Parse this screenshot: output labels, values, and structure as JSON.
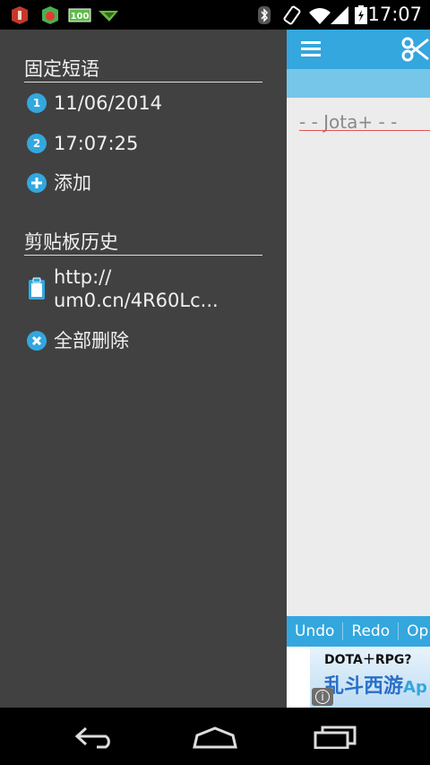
{
  "status_bar": {
    "time": "17:07",
    "notification_icons": [
      "fire-extinguisher-app-icon",
      "security-shield-app-icon",
      "battery-100-badge-icon",
      "paper-plane-app-icon"
    ],
    "system_icons": [
      "bluetooth-icon",
      "rotation-icon",
      "wifi-icon",
      "signal-icon",
      "battery-charging-icon"
    ]
  },
  "drawer": {
    "section_fixed": {
      "title": "固定短语",
      "items": [
        {
          "index": "1",
          "text": "11/06/2014"
        },
        {
          "index": "2",
          "text": "17:07:25"
        }
      ],
      "add_label": "添加"
    },
    "section_history": {
      "title": "剪贴板历史",
      "items": [
        {
          "text_line1": "http://",
          "text_line2": "um0.cn/4R60Lc..."
        }
      ],
      "delete_all_label": "全部删除"
    }
  },
  "editor": {
    "app_name_line": "- - Jota+ - -",
    "toolbar_icons": [
      "menu-icon",
      "scissors-icon"
    ]
  },
  "action_bar": {
    "buttons": [
      "Undo",
      "Redo",
      "Op"
    ]
  },
  "ad": {
    "line1": "DOTA＋RPG? ",
    "line2": "乱斗西游",
    "line2_suffix": "Ap",
    "info_glyph": "i"
  },
  "colors": {
    "accent": "#33a7de",
    "drawer_bg": "#414141",
    "editor_bg": "#ececec",
    "underline": "#e25555"
  }
}
